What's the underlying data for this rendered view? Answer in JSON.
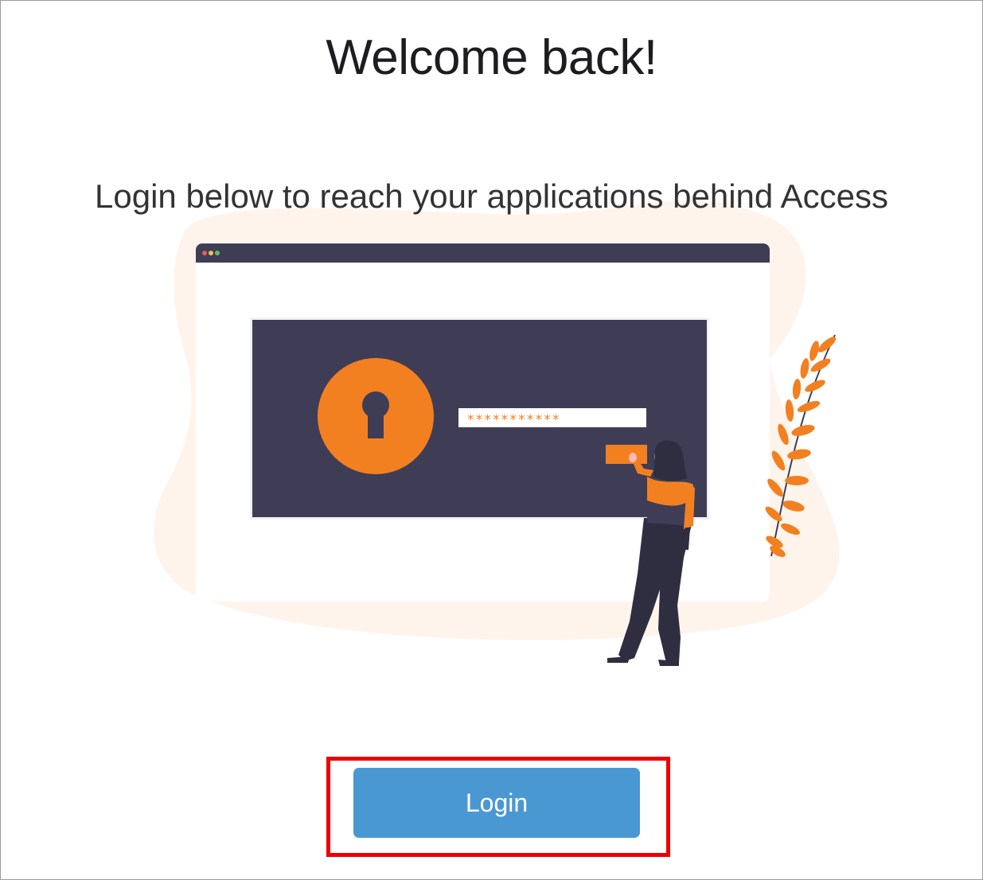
{
  "page": {
    "title": "Welcome back!",
    "subtitle": "Login below to reach your applications behind Access"
  },
  "illustration": {
    "password_mask": "***********",
    "icon": "lock-keyhole-icon"
  },
  "login": {
    "button_label": "Login"
  },
  "colors": {
    "accent_orange": "#f38020",
    "screen_dark": "#3f3d56",
    "button_blue": "#4a98d2",
    "blob_peach": "#fff4ec",
    "highlight_red": "#ee0000"
  }
}
